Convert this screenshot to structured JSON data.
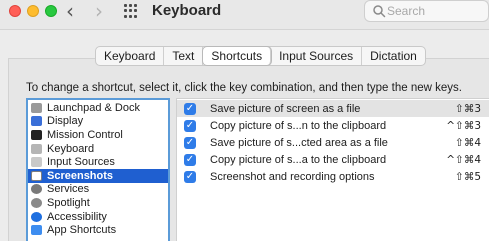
{
  "window": {
    "title": "Keyboard",
    "search_placeholder": "Search",
    "nav_back": "‹",
    "nav_forward": "›"
  },
  "tabs": [
    {
      "label": "Keyboard",
      "active": false
    },
    {
      "label": "Text",
      "active": false
    },
    {
      "label": "Shortcuts",
      "active": true
    },
    {
      "label": "Input Sources",
      "active": false
    },
    {
      "label": "Dictation",
      "active": false
    }
  ],
  "instruction": "To change a shortcut, select it, click the key combination, and then type the new keys.",
  "categories": [
    {
      "label": "Launchpad & Dock",
      "icon": "launchpad-icon",
      "color": "#9a9a9a",
      "selected": false
    },
    {
      "label": "Display",
      "icon": "display-icon",
      "color": "#3a6fd8",
      "selected": false
    },
    {
      "label": "Mission Control",
      "icon": "mission-control-icon",
      "color": "#222222",
      "selected": false
    },
    {
      "label": "Keyboard",
      "icon": "keyboard-icon",
      "color": "#b5b5b5",
      "selected": false
    },
    {
      "label": "Input Sources",
      "icon": "input-sources-icon",
      "color": "#c9c9c9",
      "selected": false
    },
    {
      "label": "Screenshots",
      "icon": "screenshot-icon",
      "color": "#7f7f7f",
      "selected": true
    },
    {
      "label": "Services",
      "icon": "gear-icon",
      "color": "#7a7a7a",
      "selected": false
    },
    {
      "label": "Spotlight",
      "icon": "spotlight-icon",
      "color": "#8a8a8a",
      "selected": false
    },
    {
      "label": "Accessibility",
      "icon": "accessibility-icon",
      "color": "#1e6fe0",
      "selected": false
    },
    {
      "label": "App Shortcuts",
      "icon": "app-shortcuts-icon",
      "color": "#3d8df0",
      "selected": false
    }
  ],
  "shortcuts": [
    {
      "checked": true,
      "label": "Save picture of screen as a file",
      "keys": "⇧⌘3"
    },
    {
      "checked": true,
      "label": "Copy picture of s...n to the clipboard",
      "keys": "^⇧⌘3"
    },
    {
      "checked": true,
      "label": "Save picture of s...cted area as a file",
      "keys": "⇧⌘4"
    },
    {
      "checked": true,
      "label": "Copy picture of s...a to the clipboard",
      "keys": "^⇧⌘4"
    },
    {
      "checked": true,
      "label": "Screenshot and recording options",
      "keys": "⇧⌘5"
    }
  ],
  "colors": {
    "selection": "#1f5fd0",
    "checkbox": "#2f7ce8",
    "list_focus_ring": "#5b9bd8"
  }
}
